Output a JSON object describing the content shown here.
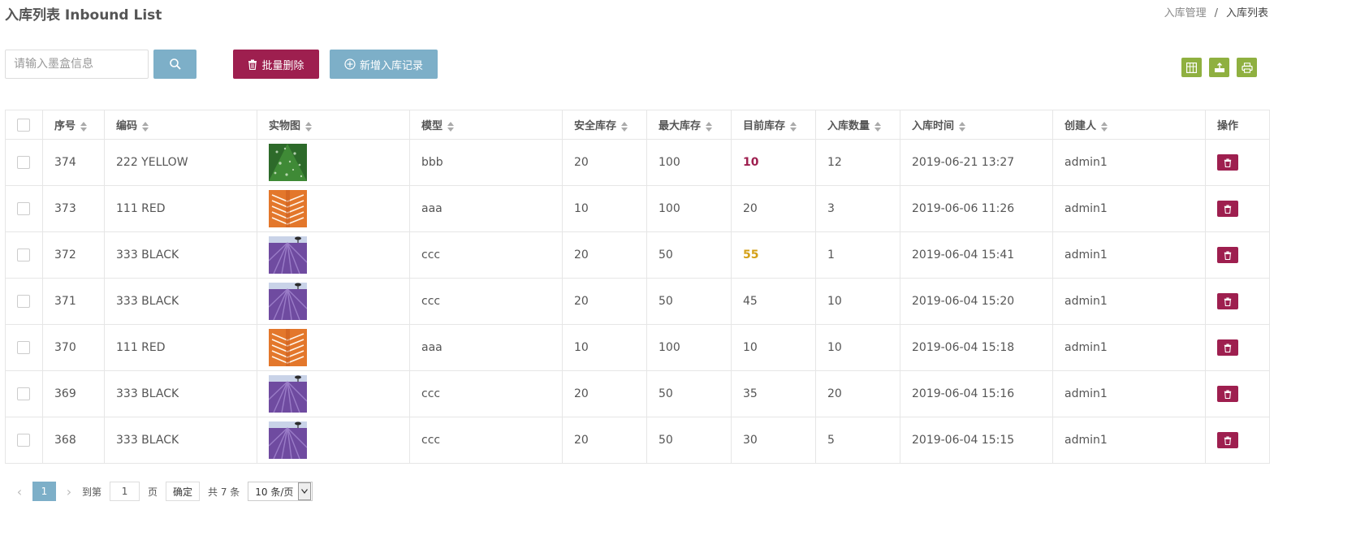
{
  "header": {
    "title": "入库列表 Inbound List",
    "breadcrumb": [
      "入库管理",
      "入库列表"
    ]
  },
  "toolbar": {
    "search_placeholder": "请输入墨盒信息",
    "batch_delete_label": "批量删除",
    "add_label": "新增入库记录",
    "tools": [
      "columns-icon",
      "export-icon",
      "print-icon"
    ]
  },
  "table": {
    "columns": [
      "序号",
      "编码",
      "实物图",
      "模型",
      "安全库存",
      "最大库存",
      "目前库存",
      "入库数量",
      "入库时间",
      "创建人",
      "操作"
    ],
    "rows": [
      {
        "id": "374",
        "code": "222 YELLOW",
        "image": "green-leaf",
        "model": "bbb",
        "safe": "20",
        "max": "100",
        "current": "10",
        "status": "low",
        "qty": "12",
        "time": "2019-06-21 13:27",
        "creator": "admin1"
      },
      {
        "id": "373",
        "code": "111 RED",
        "image": "orange-arch",
        "model": "aaa",
        "safe": "10",
        "max": "100",
        "current": "20",
        "status": "normal",
        "qty": "3",
        "time": "2019-06-06 11:26",
        "creator": "admin1"
      },
      {
        "id": "372",
        "code": "333 BLACK",
        "image": "lavender",
        "model": "ccc",
        "safe": "20",
        "max": "50",
        "current": "55",
        "status": "over",
        "qty": "1",
        "time": "2019-06-04 15:41",
        "creator": "admin1"
      },
      {
        "id": "371",
        "code": "333 BLACK",
        "image": "lavender",
        "model": "ccc",
        "safe": "20",
        "max": "50",
        "current": "45",
        "status": "normal",
        "qty": "10",
        "time": "2019-06-04 15:20",
        "creator": "admin1"
      },
      {
        "id": "370",
        "code": "111 RED",
        "image": "orange-arch",
        "model": "aaa",
        "safe": "10",
        "max": "100",
        "current": "10",
        "status": "normal",
        "qty": "10",
        "time": "2019-06-04 15:18",
        "creator": "admin1"
      },
      {
        "id": "369",
        "code": "333 BLACK",
        "image": "lavender",
        "model": "ccc",
        "safe": "20",
        "max": "50",
        "current": "35",
        "status": "normal",
        "qty": "20",
        "time": "2019-06-04 15:16",
        "creator": "admin1"
      },
      {
        "id": "368",
        "code": "333 BLACK",
        "image": "lavender",
        "model": "ccc",
        "safe": "20",
        "max": "50",
        "current": "30",
        "status": "normal",
        "qty": "5",
        "time": "2019-06-04 15:15",
        "creator": "admin1"
      }
    ]
  },
  "pagination": {
    "current_page": "1",
    "goto_label": "到第",
    "goto_value": "1",
    "page_label": "页",
    "confirm_label": "确定",
    "total_label": "共 7 条",
    "page_size": "10 条/页"
  },
  "colors": {
    "primary": "#7dafc8",
    "danger": "#9e1f4f",
    "tool": "#8fb040",
    "warning": "#d4a017"
  }
}
